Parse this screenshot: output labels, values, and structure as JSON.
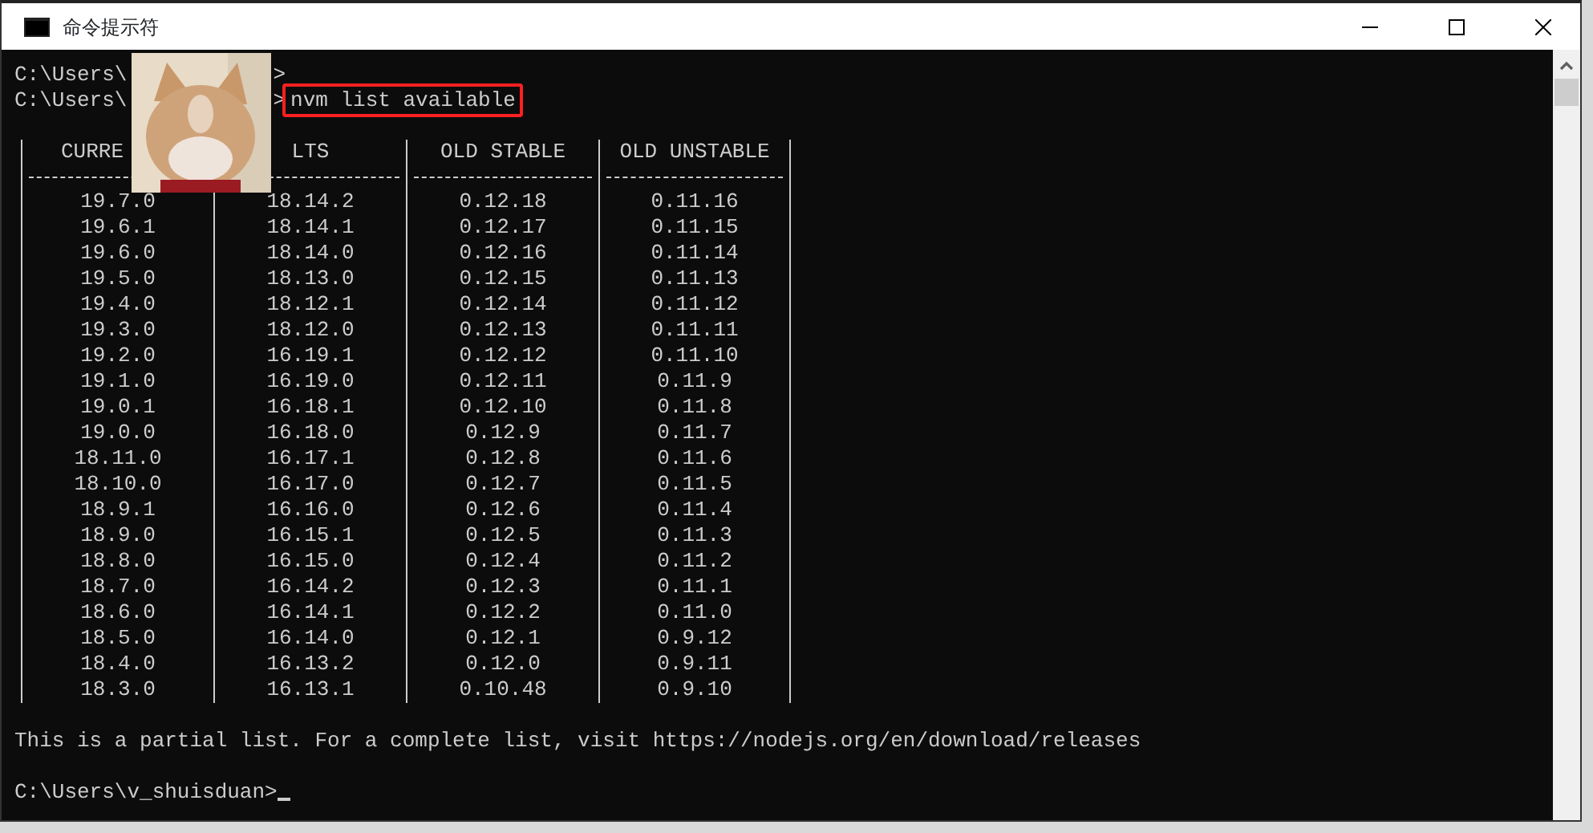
{
  "window": {
    "title": "命令提示符"
  },
  "console": {
    "prompts": [
      {
        "parts": [
          "C:\\Users\\",
          ">"
        ]
      },
      {
        "parts": [
          "C:\\Users\\",
          ">"
        ],
        "command": "nvm list available",
        "highlighted": true
      }
    ],
    "table": {
      "columns": [
        "CURRE",
        "LTS",
        "OLD STABLE",
        "OLD UNSTABLE"
      ],
      "rows": [
        [
          "19.7.0",
          "18.14.2",
          "0.12.18",
          "0.11.16"
        ],
        [
          "19.6.1",
          "18.14.1",
          "0.12.17",
          "0.11.15"
        ],
        [
          "19.6.0",
          "18.14.0",
          "0.12.16",
          "0.11.14"
        ],
        [
          "19.5.0",
          "18.13.0",
          "0.12.15",
          "0.11.13"
        ],
        [
          "19.4.0",
          "18.12.1",
          "0.12.14",
          "0.11.12"
        ],
        [
          "19.3.0",
          "18.12.0",
          "0.12.13",
          "0.11.11"
        ],
        [
          "19.2.0",
          "16.19.1",
          "0.12.12",
          "0.11.10"
        ],
        [
          "19.1.0",
          "16.19.0",
          "0.12.11",
          "0.11.9"
        ],
        [
          "19.0.1",
          "16.18.1",
          "0.12.10",
          "0.11.8"
        ],
        [
          "19.0.0",
          "16.18.0",
          "0.12.9",
          "0.11.7"
        ],
        [
          "18.11.0",
          "16.17.1",
          "0.12.8",
          "0.11.6"
        ],
        [
          "18.10.0",
          "16.17.0",
          "0.12.7",
          "0.11.5"
        ],
        [
          "18.9.1",
          "16.16.0",
          "0.12.6",
          "0.11.4"
        ],
        [
          "18.9.0",
          "16.15.1",
          "0.12.5",
          "0.11.3"
        ],
        [
          "18.8.0",
          "16.15.0",
          "0.12.4",
          "0.11.2"
        ],
        [
          "18.7.0",
          "16.14.2",
          "0.12.3",
          "0.11.1"
        ],
        [
          "18.6.0",
          "16.14.1",
          "0.12.2",
          "0.11.0"
        ],
        [
          "18.5.0",
          "16.14.0",
          "0.12.1",
          "0.9.12"
        ],
        [
          "18.4.0",
          "16.13.2",
          "0.12.0",
          "0.9.11"
        ],
        [
          "18.3.0",
          "16.13.1",
          "0.10.48",
          "0.9.10"
        ]
      ]
    },
    "message": "This is a partial list. For a complete list, visit https://nodejs.org/en/download/releases",
    "final_prompt": "C:\\Users\\v_shuisduan>",
    "cursor": true
  }
}
